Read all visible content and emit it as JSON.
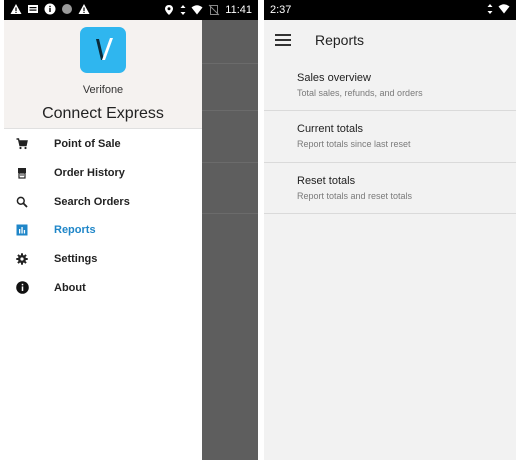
{
  "left_screen": {
    "status_bar": {
      "time": "11:41",
      "left_icons": [
        "warning-icon",
        "sim-card-icon",
        "info-icon",
        "circle-icon",
        "warning-icon"
      ],
      "right_icons": [
        "location-icon",
        "data-arrows-icon",
        "wifi-icon",
        "no-sim-icon"
      ]
    },
    "drawer": {
      "brand_line1": "Verifone",
      "brand_line2": "Connect Express",
      "logo_icon": "verifone-logo-icon",
      "items": [
        {
          "label": "Point of Sale",
          "icon": "cart-icon",
          "active": false
        },
        {
          "label": "Order History",
          "icon": "receipt-icon",
          "active": false
        },
        {
          "label": "Search Orders",
          "icon": "search-icon",
          "active": false
        },
        {
          "label": "Reports",
          "icon": "bar-chart-icon",
          "active": true
        },
        {
          "label": "Settings",
          "icon": "gear-icon",
          "active": false
        },
        {
          "label": "About",
          "icon": "info-icon",
          "active": false
        }
      ]
    }
  },
  "right_screen": {
    "status_bar": {
      "time": "2:37",
      "right_icons": [
        "data-arrows-icon",
        "wifi-icon"
      ]
    },
    "app_bar": {
      "title": "Reports",
      "menu_icon": "hamburger-icon"
    },
    "reports": [
      {
        "title": "Sales overview",
        "subtitle": "Total sales, refunds, and orders"
      },
      {
        "title": "Current totals",
        "subtitle": "Report totals since last reset"
      },
      {
        "title": "Reset totals",
        "subtitle": "Report totals and reset totals"
      }
    ]
  },
  "colors": {
    "accent": "#1f86c8",
    "logo": "#2fb6ef",
    "scrim": "#5e5e5e"
  }
}
